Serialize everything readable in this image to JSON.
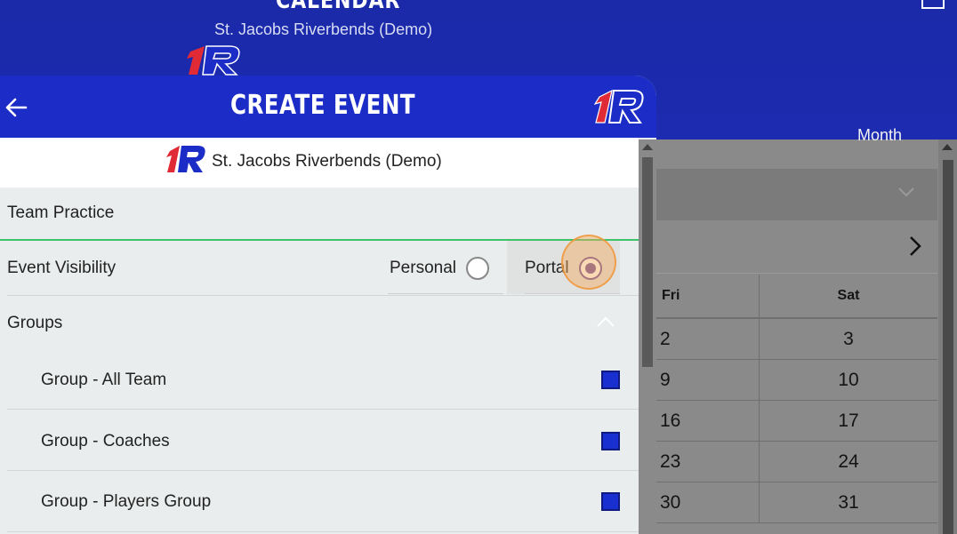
{
  "background": {
    "title": "CALENDAR",
    "subtitle": "St. Jacobs Riverbends (Demo)",
    "view_label": "Month",
    "calendar": {
      "headers": [
        "Fri",
        "Sat"
      ],
      "rows": [
        [
          "2",
          "3"
        ],
        [
          "9",
          "10"
        ],
        [
          "16",
          "17"
        ],
        [
          "23",
          "24"
        ],
        [
          "30",
          "31"
        ]
      ]
    }
  },
  "modal": {
    "title": "CREATE EVENT",
    "club_name": "St. Jacobs Riverbends (Demo)",
    "event_title_value": "Team Practice",
    "visibility": {
      "label": "Event Visibility",
      "options": [
        {
          "label": "Personal",
          "selected": false
        },
        {
          "label": "Portal",
          "selected": true
        }
      ]
    },
    "groups": {
      "label": "Groups",
      "expanded": true,
      "items": [
        {
          "label": "Group - All Team",
          "checked": true
        },
        {
          "label": "Group - Coaches",
          "checked": true
        },
        {
          "label": "Group - Players Group",
          "checked": true
        }
      ]
    }
  },
  "colors": {
    "header_blue": "#1c2cc6",
    "accent_green": "#3ec26a",
    "radio_purple": "#6b4e9b",
    "checkbox_blue": "#1a2fd0",
    "logo_red": "#e02a36"
  },
  "icons": {
    "back": "arrow-left-icon",
    "logo": "1r-logo-icon",
    "groups_toggle": "chevron-up-icon",
    "month_toggle": "chevron-down-icon",
    "next": "chevron-right-icon"
  }
}
